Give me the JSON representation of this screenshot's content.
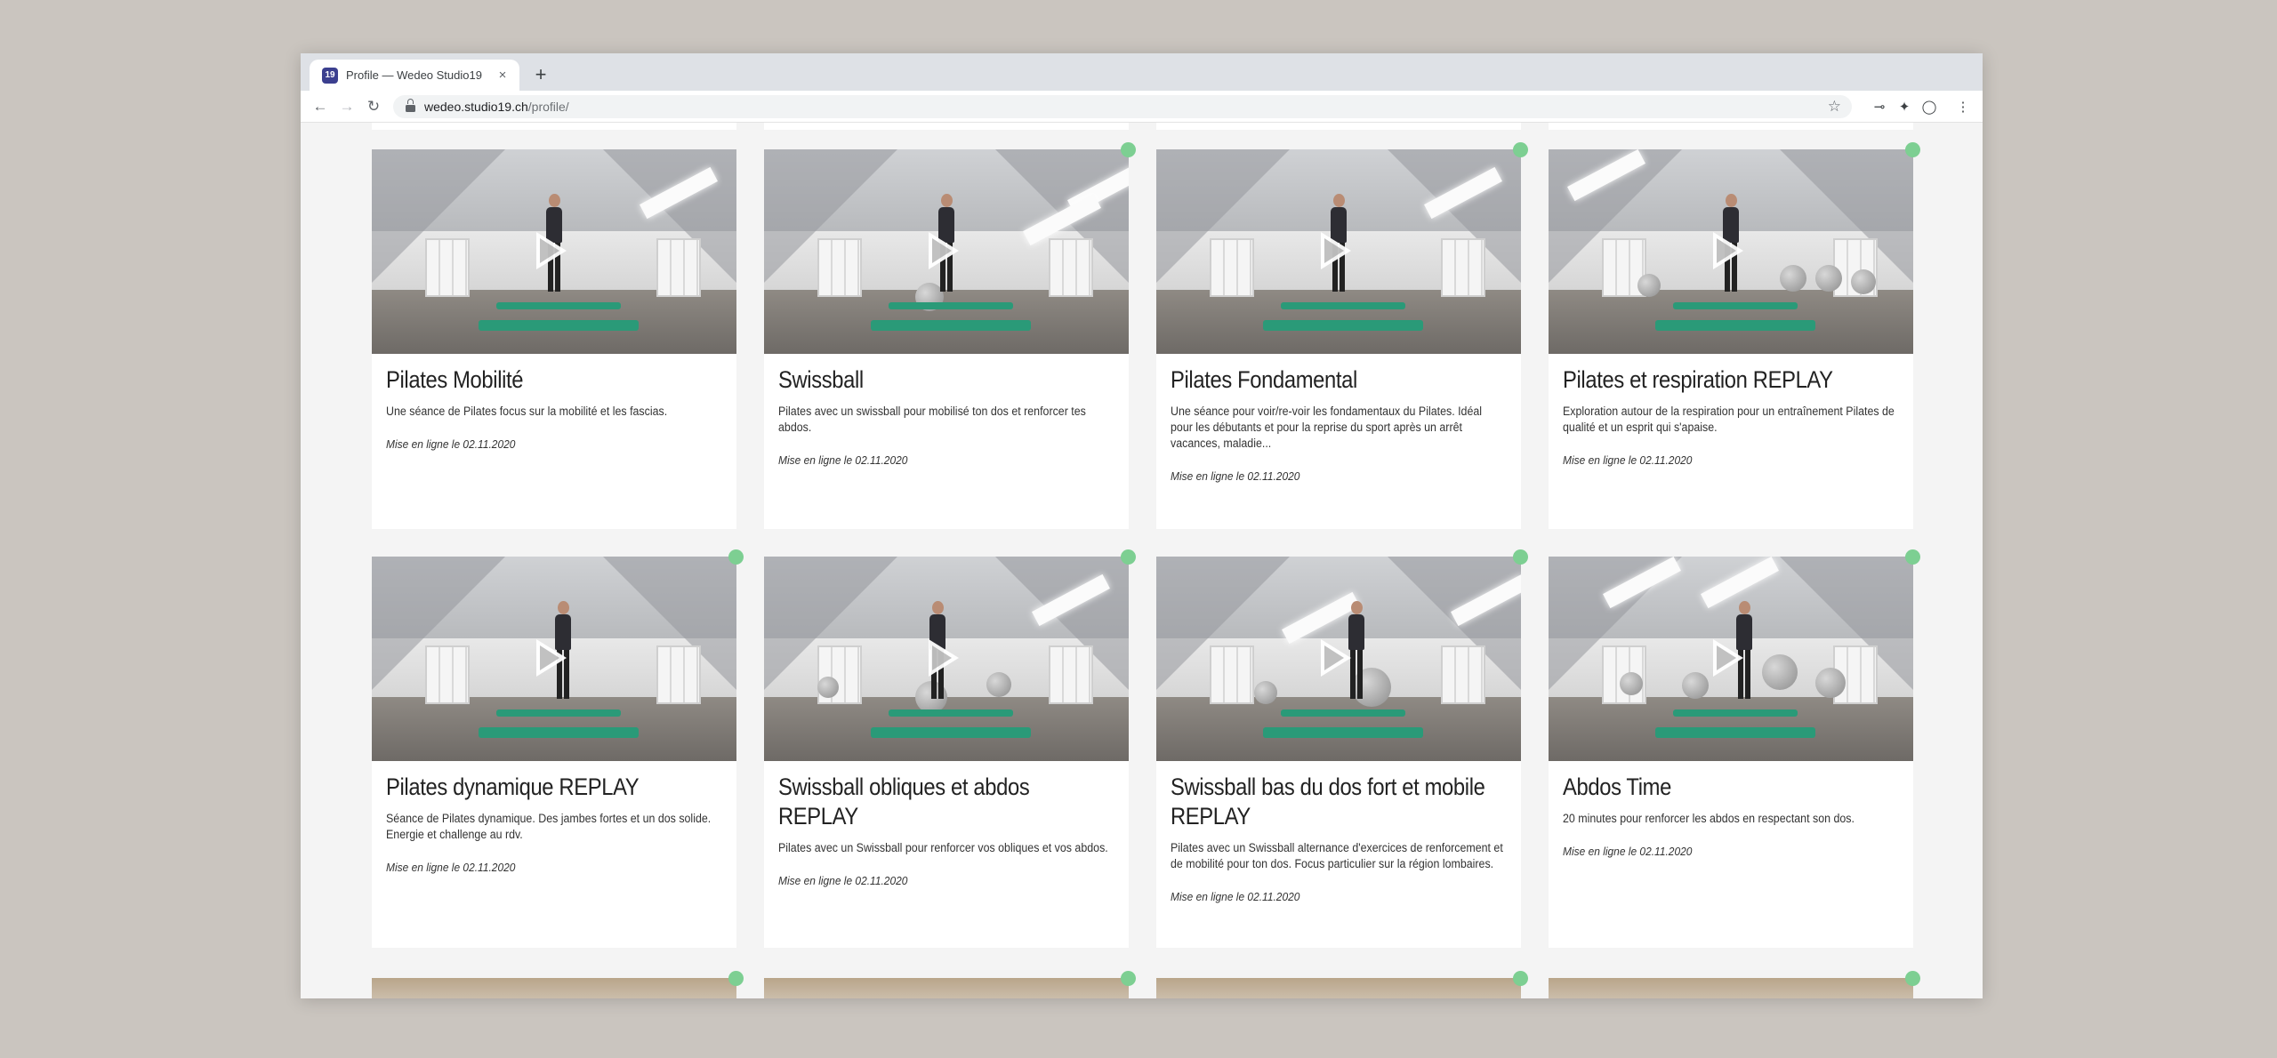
{
  "browser": {
    "tab_title": "Profile — Wedeo Studio19",
    "tab_close": "×",
    "new_tab": "+",
    "favicon_text": "19",
    "url_host": "wedeo.studio19.ch",
    "url_path": "/profile/",
    "icons": [
      "back-arrow-icon",
      "forward-arrow-icon",
      "reload-icon",
      "lock-icon",
      "star-icon",
      "pin-icon",
      "puzzle-icon",
      "extension-icon",
      "menu-dots-icon"
    ]
  },
  "colors": {
    "accent_mat": "#2a9a78",
    "status_dot": "#7dcf92"
  },
  "videos": [
    {
      "title": "Pilates Mobilité",
      "description": "Une séance de Pilates focus sur la mobilité et les fascias.",
      "date": "Mise en ligne le 02.11.2020",
      "status": false
    },
    {
      "title": "Swissball",
      "description": "Pilates avec un swissball pour mobilisé ton dos et renforcer tes abdos.",
      "date": "Mise en ligne le 02.11.2020",
      "status": true
    },
    {
      "title": "Pilates Fondamental",
      "description": "Une séance pour voir/re-voir les fondamentaux du Pilates. Idéal pour les débutants et pour la reprise du sport après un arrêt vacances, maladie...",
      "date": "Mise en ligne le 02.11.2020",
      "status": true
    },
    {
      "title": "Pilates et respiration REPLAY",
      "description": "Exploration autour de la respiration pour un entraînement Pilates de qualité et un esprit qui s'apaise.",
      "date": "Mise en ligne le 02.11.2020",
      "status": true
    },
    {
      "title": "Pilates dynamique REPLAY",
      "description": "Séance de Pilates dynamique. Des jambes fortes et un dos solide. Energie et challenge au rdv.",
      "date": "Mise en ligne le 02.11.2020",
      "status": true
    },
    {
      "title": "Swissball obliques et abdos REPLAY",
      "description": "Pilates avec un Swissball pour renforcer vos obliques et vos abdos.",
      "date": "Mise en ligne le 02.11.2020",
      "status": true
    },
    {
      "title": "Swissball bas du dos fort et mobile REPLAY",
      "description": "Pilates avec un Swissball alternance d'exercices de renforcement et de mobilité pour ton dos. Focus particulier sur la région lombaires.",
      "date": "Mise en ligne le 02.11.2020",
      "status": true
    },
    {
      "title": "Abdos Time",
      "description": "20 minutes pour renforcer les abdos en respectant son dos.",
      "date": "Mise en ligne le 02.11.2020",
      "status": true
    }
  ]
}
